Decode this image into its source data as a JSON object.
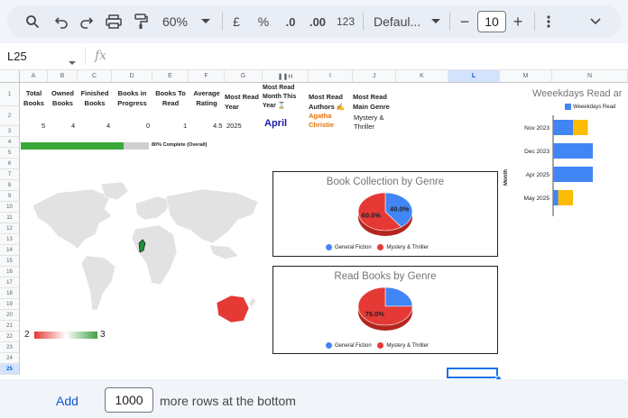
{
  "toolbar": {
    "zoom": "60%",
    "currency": "£",
    "percent": "%",
    "dec_decrease": ".0",
    "dec_increase": ".00",
    "number_format": "123",
    "font": "Defaul...",
    "font_size": "10"
  },
  "formula_bar": {
    "cell_ref": "L25",
    "fx_label": "fx"
  },
  "columns": [
    "A",
    "B",
    "C",
    "D",
    "E",
    "F",
    "G",
    "H",
    "I",
    "J",
    "K",
    "L",
    "M",
    "N"
  ],
  "selected_column": "L",
  "rows": [
    "1",
    "2",
    "3",
    "4",
    "5",
    "6",
    "7",
    "8",
    "9",
    "10",
    "11",
    "12",
    "13",
    "14",
    "15",
    "16",
    "17",
    "18",
    "19",
    "20",
    "21",
    "22",
    "23",
    "24",
    "25"
  ],
  "selected_row": "25",
  "stats": {
    "headers": [
      "Total Books",
      "Owned Books",
      "Finished Books",
      "Books in Progress",
      "Books To Read",
      "Average Rating",
      "Most Read Year",
      "Most Read Month This Year ⌛",
      "Most Read Authors ✍",
      "Most Read Main Genre"
    ],
    "values": [
      "5",
      "4",
      "4",
      "0",
      "1",
      "4.5",
      "2025",
      "April",
      "Agatha Christie",
      "Mystery & Thriller"
    ]
  },
  "progress": {
    "label": "80% Complete (Overall)",
    "fraction": 0.8
  },
  "map": {
    "legend_min": "2",
    "legend_max": "3",
    "low_color": "#e53935",
    "high_color": "#43a047"
  },
  "colors": {
    "general_fiction": "#4285f4",
    "mystery_thriller": "#e53935",
    "yellow": "#fbbc04",
    "accent": "#0b57d0"
  },
  "chart_data": [
    {
      "type": "pie",
      "title": "Book Collection by Genre",
      "categories": [
        "General Fiction",
        "Mystery & Thriller"
      ],
      "values": [
        40,
        60
      ],
      "labels": [
        "40.0%",
        "60.0%"
      ],
      "legend": "bottom"
    },
    {
      "type": "pie",
      "title": "Read Books by Genre",
      "categories": [
        "General Fiction",
        "Mystery & Thriller"
      ],
      "values": [
        25,
        75
      ],
      "labels": [
        "",
        "75.0%"
      ],
      "legend": "bottom"
    },
    {
      "type": "bar",
      "title": "Weeekdays Read ar",
      "ylabel": "Month",
      "categories": [
        "Nov 2023",
        "Dec 2023",
        "Apr 2025",
        "May 2025"
      ],
      "series": [
        {
          "name": "Weeekdays Read",
          "values": [
            2,
            4,
            4,
            0.5
          ]
        },
        {
          "name": "",
          "values": [
            1.5,
            0,
            0,
            1.5
          ]
        }
      ],
      "legend": "top"
    }
  ],
  "bottom_bar": {
    "add_label": "Add",
    "rows_value": "1000",
    "more_text": "more rows at the bottom"
  }
}
